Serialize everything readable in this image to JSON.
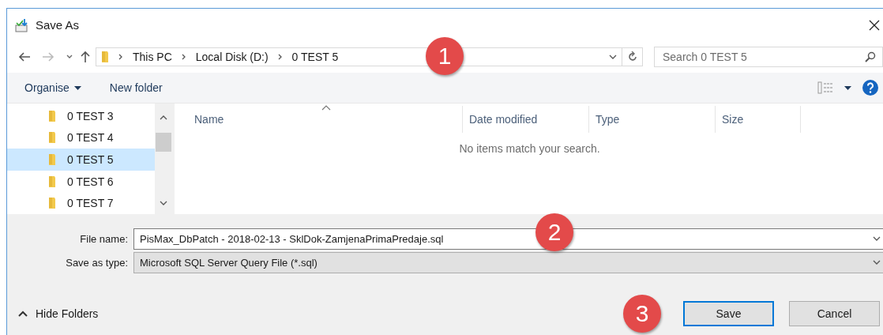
{
  "window": {
    "title": "Save As"
  },
  "address_bar": {
    "path": [
      "This PC",
      "Local Disk (D:)",
      "0 TEST 5"
    ]
  },
  "search": {
    "placeholder": "Search 0 TEST 5"
  },
  "toolbar": {
    "organise": "Organise",
    "new_folder": "New folder"
  },
  "sidebar": {
    "items": [
      {
        "label": "0 TEST 3",
        "selected": false
      },
      {
        "label": "0 TEST 4",
        "selected": false
      },
      {
        "label": "0 TEST 5",
        "selected": true
      },
      {
        "label": "0 TEST 6",
        "selected": false
      },
      {
        "label": "0 TEST 7",
        "selected": false
      }
    ]
  },
  "table": {
    "columns": [
      "Name",
      "Date modified",
      "Type",
      "Size"
    ],
    "empty_message": "No items match your search."
  },
  "form": {
    "fields": [
      {
        "label": "File name:",
        "value": "PisMax_DbPatch - 2018-02-13 - SklDok-ZamjenaPrimaPredaje.sql",
        "kind": "input"
      },
      {
        "label": "Save as type:",
        "value": "Microsoft SQL Server Query File (*.sql)",
        "kind": "select"
      }
    ]
  },
  "hide_folders": "Hide Folders",
  "buttons": [
    {
      "label": "Save",
      "default": true
    },
    {
      "label": "Cancel",
      "default": false
    }
  ],
  "callouts": [
    "1",
    "2",
    "3"
  ]
}
